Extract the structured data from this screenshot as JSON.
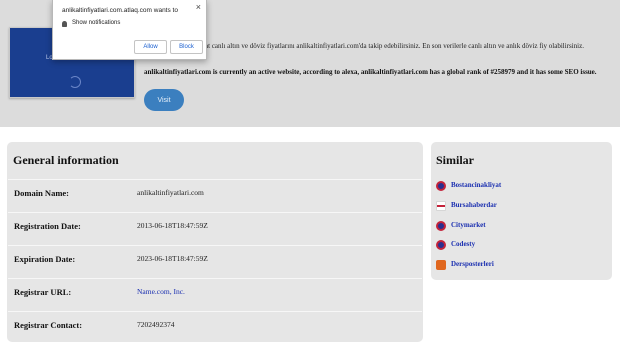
{
  "notification": {
    "title": "anlikaltinfiyatlari.com.atlaq.com wants to",
    "close": "×",
    "message": "Show notifications",
    "allow_label": "Allow",
    "block_label": "Block"
  },
  "hero": {
    "preview_label": "Lo",
    "description": "tfau aracılığıyla 24-saat canlı altın ve döviz fiyatlarını anlikaltinfiyatlari.com'da takip edebilirsiniz. En son verilerle canlı altın ve anlık döviz fiy olabilirsiniz.",
    "rank_text": "anlikaltinfiyatlari.com is currently an active website, according to alexa, anlikaltinfiyatlari.com has a global rank of #258979 and it has some SEO issue.",
    "visit_label": "Visit"
  },
  "general": {
    "title": "General information",
    "rows": [
      {
        "key": "Domain Name:",
        "value": "anlikaltinfiyatlari.com"
      },
      {
        "key": "Registration Date:",
        "value": "2013-06-18T18:47:59Z"
      },
      {
        "key": "Expiration Date:",
        "value": "2023-06-18T18:47:59Z"
      },
      {
        "key": "Registrar URL:",
        "value": "Name.com, Inc."
      },
      {
        "key": "Registrar Contact:",
        "value": "7202492374"
      }
    ]
  },
  "similar": {
    "title": "Similar",
    "items": [
      {
        "label": "Bostancinakliyat",
        "icon": "site-favicon-icon"
      },
      {
        "label": "Bursahaberdar",
        "icon": "flag-favicon-icon"
      },
      {
        "label": "Citymarket",
        "icon": "site-favicon-icon"
      },
      {
        "label": "Codesty",
        "icon": "site-favicon-icon"
      },
      {
        "label": "Dersposterleri",
        "icon": "dp-favicon-icon"
      }
    ]
  }
}
